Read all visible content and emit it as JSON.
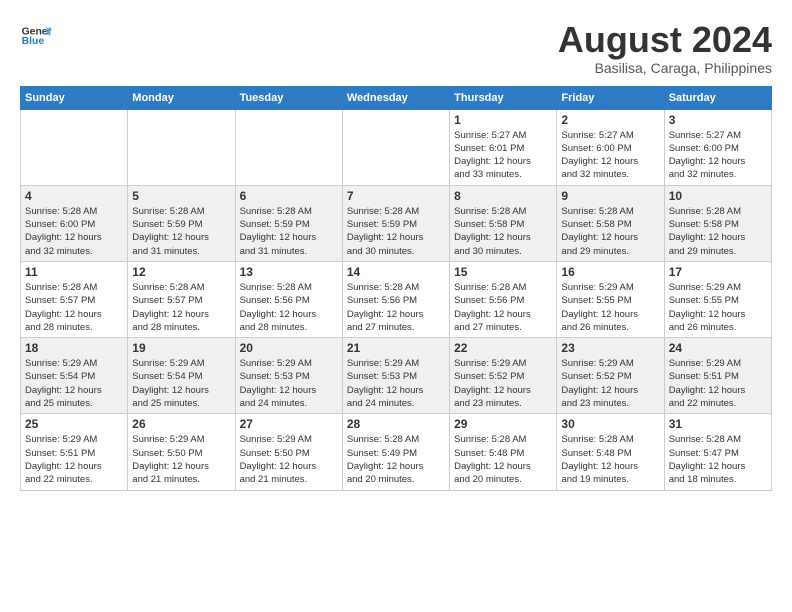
{
  "header": {
    "logo_line1": "General",
    "logo_line2": "Blue",
    "month_year": "August 2024",
    "location": "Basilisa, Caraga, Philippines"
  },
  "weekdays": [
    "Sunday",
    "Monday",
    "Tuesday",
    "Wednesday",
    "Thursday",
    "Friday",
    "Saturday"
  ],
  "weeks": [
    [
      {
        "day": "",
        "info": ""
      },
      {
        "day": "",
        "info": ""
      },
      {
        "day": "",
        "info": ""
      },
      {
        "day": "",
        "info": ""
      },
      {
        "day": "1",
        "info": "Sunrise: 5:27 AM\nSunset: 6:01 PM\nDaylight: 12 hours\nand 33 minutes."
      },
      {
        "day": "2",
        "info": "Sunrise: 5:27 AM\nSunset: 6:00 PM\nDaylight: 12 hours\nand 32 minutes."
      },
      {
        "day": "3",
        "info": "Sunrise: 5:27 AM\nSunset: 6:00 PM\nDaylight: 12 hours\nand 32 minutes."
      }
    ],
    [
      {
        "day": "4",
        "info": "Sunrise: 5:28 AM\nSunset: 6:00 PM\nDaylight: 12 hours\nand 32 minutes."
      },
      {
        "day": "5",
        "info": "Sunrise: 5:28 AM\nSunset: 5:59 PM\nDaylight: 12 hours\nand 31 minutes."
      },
      {
        "day": "6",
        "info": "Sunrise: 5:28 AM\nSunset: 5:59 PM\nDaylight: 12 hours\nand 31 minutes."
      },
      {
        "day": "7",
        "info": "Sunrise: 5:28 AM\nSunset: 5:59 PM\nDaylight: 12 hours\nand 30 minutes."
      },
      {
        "day": "8",
        "info": "Sunrise: 5:28 AM\nSunset: 5:58 PM\nDaylight: 12 hours\nand 30 minutes."
      },
      {
        "day": "9",
        "info": "Sunrise: 5:28 AM\nSunset: 5:58 PM\nDaylight: 12 hours\nand 29 minutes."
      },
      {
        "day": "10",
        "info": "Sunrise: 5:28 AM\nSunset: 5:58 PM\nDaylight: 12 hours\nand 29 minutes."
      }
    ],
    [
      {
        "day": "11",
        "info": "Sunrise: 5:28 AM\nSunset: 5:57 PM\nDaylight: 12 hours\nand 28 minutes."
      },
      {
        "day": "12",
        "info": "Sunrise: 5:28 AM\nSunset: 5:57 PM\nDaylight: 12 hours\nand 28 minutes."
      },
      {
        "day": "13",
        "info": "Sunrise: 5:28 AM\nSunset: 5:56 PM\nDaylight: 12 hours\nand 28 minutes."
      },
      {
        "day": "14",
        "info": "Sunrise: 5:28 AM\nSunset: 5:56 PM\nDaylight: 12 hours\nand 27 minutes."
      },
      {
        "day": "15",
        "info": "Sunrise: 5:28 AM\nSunset: 5:56 PM\nDaylight: 12 hours\nand 27 minutes."
      },
      {
        "day": "16",
        "info": "Sunrise: 5:29 AM\nSunset: 5:55 PM\nDaylight: 12 hours\nand 26 minutes."
      },
      {
        "day": "17",
        "info": "Sunrise: 5:29 AM\nSunset: 5:55 PM\nDaylight: 12 hours\nand 26 minutes."
      }
    ],
    [
      {
        "day": "18",
        "info": "Sunrise: 5:29 AM\nSunset: 5:54 PM\nDaylight: 12 hours\nand 25 minutes."
      },
      {
        "day": "19",
        "info": "Sunrise: 5:29 AM\nSunset: 5:54 PM\nDaylight: 12 hours\nand 25 minutes."
      },
      {
        "day": "20",
        "info": "Sunrise: 5:29 AM\nSunset: 5:53 PM\nDaylight: 12 hours\nand 24 minutes."
      },
      {
        "day": "21",
        "info": "Sunrise: 5:29 AM\nSunset: 5:53 PM\nDaylight: 12 hours\nand 24 minutes."
      },
      {
        "day": "22",
        "info": "Sunrise: 5:29 AM\nSunset: 5:52 PM\nDaylight: 12 hours\nand 23 minutes."
      },
      {
        "day": "23",
        "info": "Sunrise: 5:29 AM\nSunset: 5:52 PM\nDaylight: 12 hours\nand 23 minutes."
      },
      {
        "day": "24",
        "info": "Sunrise: 5:29 AM\nSunset: 5:51 PM\nDaylight: 12 hours\nand 22 minutes."
      }
    ],
    [
      {
        "day": "25",
        "info": "Sunrise: 5:29 AM\nSunset: 5:51 PM\nDaylight: 12 hours\nand 22 minutes."
      },
      {
        "day": "26",
        "info": "Sunrise: 5:29 AM\nSunset: 5:50 PM\nDaylight: 12 hours\nand 21 minutes."
      },
      {
        "day": "27",
        "info": "Sunrise: 5:29 AM\nSunset: 5:50 PM\nDaylight: 12 hours\nand 21 minutes."
      },
      {
        "day": "28",
        "info": "Sunrise: 5:28 AM\nSunset: 5:49 PM\nDaylight: 12 hours\nand 20 minutes."
      },
      {
        "day": "29",
        "info": "Sunrise: 5:28 AM\nSunset: 5:48 PM\nDaylight: 12 hours\nand 20 minutes."
      },
      {
        "day": "30",
        "info": "Sunrise: 5:28 AM\nSunset: 5:48 PM\nDaylight: 12 hours\nand 19 minutes."
      },
      {
        "day": "31",
        "info": "Sunrise: 5:28 AM\nSunset: 5:47 PM\nDaylight: 12 hours\nand 18 minutes."
      }
    ]
  ]
}
